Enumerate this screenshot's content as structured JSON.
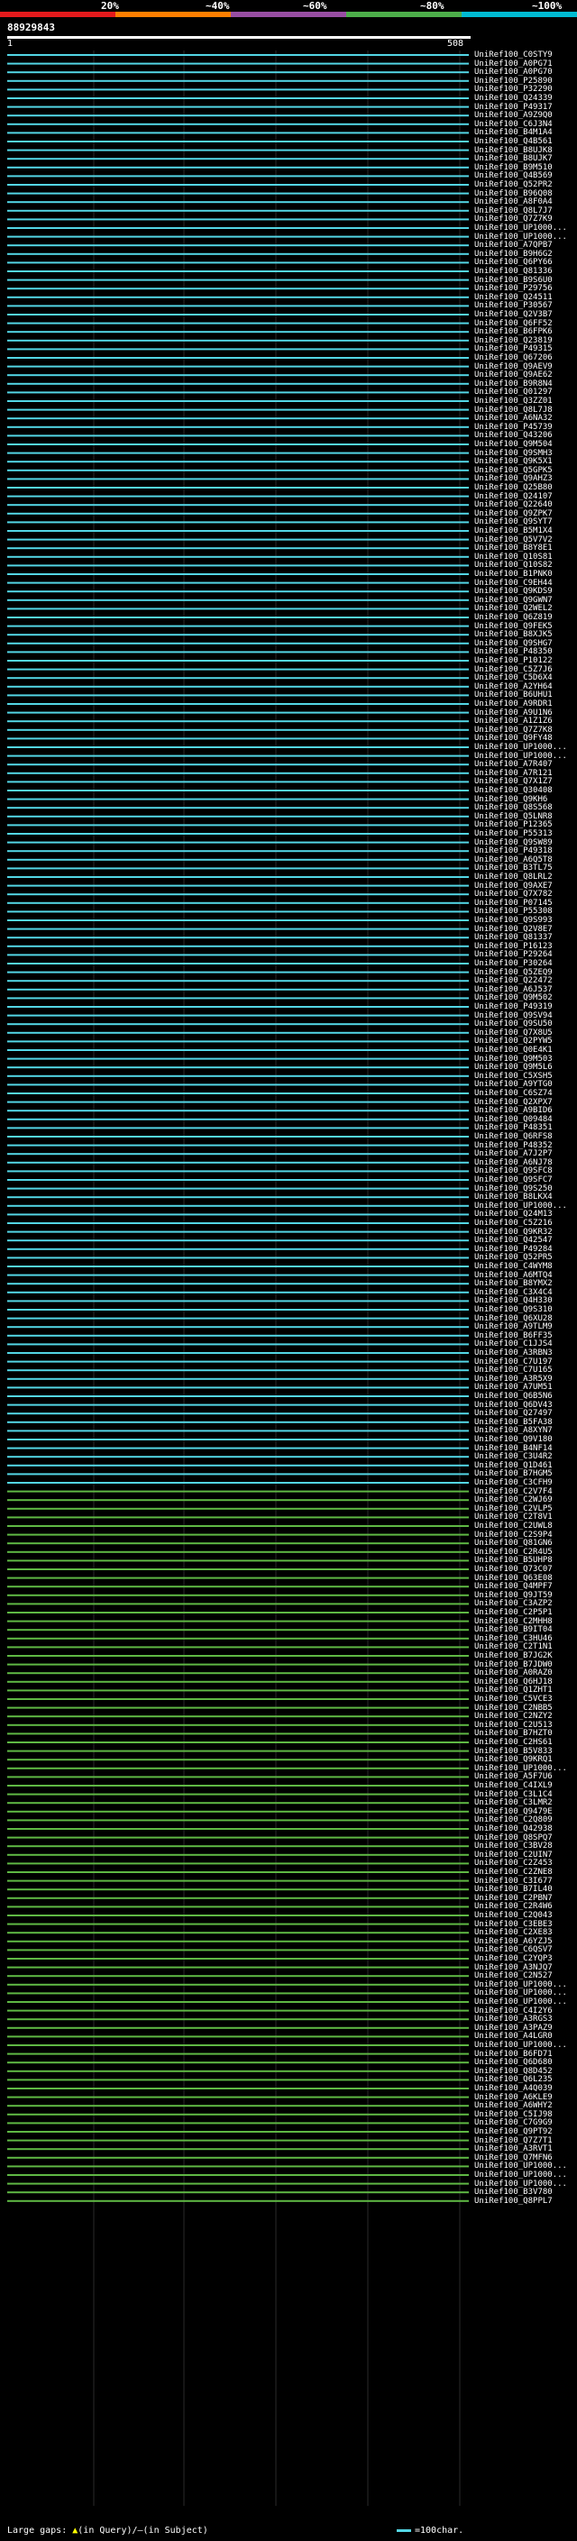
{
  "legend": {
    "ticks": [
      "20%",
      "~40%",
      "~60%",
      "~80%",
      "~100%"
    ],
    "colors": [
      "#e41a1c",
      "#ff7f00",
      "#984ea3",
      "#4daf4a",
      "#00bcd4"
    ]
  },
  "query": {
    "id": "88929843",
    "start": "1",
    "end": "508"
  },
  "hit_colors": {
    "cyan": "#53d6e5",
    "green": "#5fb844"
  },
  "hits": [
    "UniRef100_C0STY9",
    "UniRef100_A0PG71",
    "UniRef100_A0PG70",
    "UniRef100_P25890",
    "UniRef100_P32290",
    "UniRef100_Q24339",
    "UniRef100_P49317",
    "UniRef100_A9Z9Q0",
    "UniRef100_C6J3N4",
    "UniRef100_B4M1A4",
    "UniRef100_Q4B561",
    "UniRef100_B8UJK8",
    "UniRef100_B8UJK7",
    "UniRef100_B9M510",
    "UniRef100_Q4B569",
    "UniRef100_Q52PR2",
    "UniRef100_B96Q08",
    "UniRef100_A8F0A4",
    "UniRef100_Q8L7J7",
    "UniRef100_Q7Z7K9",
    "UniRef100_UP1000...",
    "UniRef100_UP1000...",
    "UniRef100_A7QPB7",
    "UniRef100_B9H6G2",
    "UniRef100_Q6PY66",
    "UniRef100_Q81336",
    "UniRef100_B9S6U0",
    "UniRef100_P29756",
    "UniRef100_Q24511",
    "UniRef100_P30567",
    "UniRef100_Q2V3B7",
    "UniRef100_Q6FF52",
    "UniRef100_B6FPK6",
    "UniRef100_Q23819",
    "UniRef100_P49315",
    "UniRef100_Q67206",
    "UniRef100_Q9AEV9",
    "UniRef100_Q9AE62",
    "UniRef100_B9R8N4",
    "UniRef100_Q01297",
    "UniRef100_Q3ZZ01",
    "UniRef100_Q8L7J8",
    "UniRef100_A6NA32",
    "UniRef100_P45739",
    "UniRef100_Q43206",
    "UniRef100_Q9M504",
    "UniRef100_Q9SMH3",
    "UniRef100_Q9K5X1",
    "UniRef100_Q5GPK5",
    "UniRef100_Q9AHZ3",
    "UniRef100_Q25B80",
    "UniRef100_Q24107",
    "UniRef100_Q22640",
    "UniRef100_Q9ZPK7",
    "UniRef100_Q9SYT7",
    "UniRef100_B5M1X4",
    "UniRef100_Q5V7V2",
    "UniRef100_B8Y8E1",
    "UniRef100_Q10S81",
    "UniRef100_Q10S82",
    "UniRef100_B1PNK0",
    "UniRef100_C9EH44",
    "UniRef100_Q9KDS9",
    "UniRef100_Q9GWN7",
    "UniRef100_Q2WEL2",
    "UniRef100_Q6Z819",
    "UniRef100_Q9FEK5",
    "UniRef100_B8XJK5",
    "UniRef100_Q9SHG7",
    "UniRef100_P48350",
    "UniRef100_P10122",
    "UniRef100_C5Z7J6",
    "UniRef100_C5D6X4",
    "UniRef100_A2YH64",
    "UniRef100_B6UHU1",
    "UniRef100_A9RDR1",
    "UniRef100_A9U1N6",
    "UniRef100_A1Z1Z6",
    "UniRef100_Q7Z7K8",
    "UniRef100_Q9FY48",
    "UniRef100_UP1000...",
    "UniRef100_UP1000...",
    "UniRef100_A7R407",
    "UniRef100_A7R121",
    "UniRef100_Q7X1Z7",
    "UniRef100_Q30408",
    "UniRef100_Q9KH6",
    "UniRef100_Q8S568",
    "UniRef100_Q5LNR8",
    "UniRef100_P12365",
    "UniRef100_P55313",
    "UniRef100_Q9SW89",
    "UniRef100_P49318",
    "UniRef100_A6Q5T8",
    "UniRef100_B3TL75",
    "UniRef100_Q8LRL2",
    "UniRef100_Q9AXE7",
    "UniRef100_Q7X782",
    "UniRef100_P07145",
    "UniRef100_P55308",
    "UniRef100_Q9S993",
    "UniRef100_Q2V8E7",
    "UniRef100_Q81337",
    "UniRef100_P16123",
    "UniRef100_P29264",
    "UniRef100_P30264",
    "UniRef100_Q5ZEQ9",
    "UniRef100_Q22472",
    "UniRef100_A6J537",
    "UniRef100_Q9M502",
    "UniRef100_P49319",
    "UniRef100_Q9SV94",
    "UniRef100_Q9SU50",
    "UniRef100_Q7X8U5",
    "UniRef100_Q2PYW5",
    "UniRef100_Q0E4K1",
    "UniRef100_Q9M503",
    "UniRef100_Q9M5L6",
    "UniRef100_C5XSH5",
    "UniRef100_A9YTG0",
    "UniRef100_C6SZ74",
    "UniRef100_Q2XPX7",
    "UniRef100_A9BID6",
    "UniRef100_Q09484",
    "UniRef100_P48351",
    "UniRef100_Q6RFS8",
    "UniRef100_P48352",
    "UniRef100_A7J2P7",
    "UniRef100_A6NJ78",
    "UniRef100_Q9SFC8",
    "UniRef100_Q9SFC7",
    "UniRef100_Q9S250",
    "UniRef100_B8LKX4",
    "UniRef100_UP1000...",
    "UniRef100_Q24M13",
    "UniRef100_C5Z216",
    "UniRef100_Q9KR32",
    "UniRef100_Q42547",
    "UniRef100_P49284",
    "UniRef100_Q52PR5",
    "UniRef100_C4WYM8",
    "UniRef100_A6MTQ4",
    "UniRef100_B8YMX2",
    "UniRef100_C3X4C4",
    "UniRef100_Q4H330",
    "UniRef100_Q9S310",
    "UniRef100_Q6XU28",
    "UniRef100_A9TLM9",
    "UniRef100_B6FF35",
    "UniRef100_C1JJS4",
    "UniRef100_A3RBN3",
    "UniRef100_C7U197",
    "UniRef100_C7U165",
    "UniRef100_A3R5X9",
    "UniRef100_A7UM51",
    "UniRef100_Q6B5N6",
    "UniRef100_Q6DV43",
    "UniRef100_Q27497",
    "UniRef100_B5FA38",
    "UniRef100_A8XYN7",
    "UniRef100_Q9V180",
    "UniRef100_B4NF14",
    "UniRef100_C3U4R2",
    "UniRef100_Q1D461",
    "UniRef100_B7HGM5",
    "UniRef100_C3CFH9",
    "UniRef100_C2V7F4",
    "UniRef100_C2WJ69",
    "UniRef100_C2VLP5",
    "UniRef100_C2T8V1",
    "UniRef100_C2UWL8",
    "UniRef100_C2S9P4",
    "UniRef100_Q81GN6",
    "UniRef100_C2R4U5",
    "UniRef100_B5UHP8",
    "UniRef100_Q73C07",
    "UniRef100_Q63E08",
    "UniRef100_Q4MPF7",
    "UniRef100_Q9JT59",
    "UniRef100_C3AZP2",
    "UniRef100_C2P5P1",
    "UniRef100_C2MHH8",
    "UniRef100_B9IT04",
    "UniRef100_C3HU46",
    "UniRef100_C2T1N1",
    "UniRef100_B7JG2K",
    "UniRef100_B7JDW0",
    "UniRef100_A0RAZ0",
    "UniRef100_Q6HJ18",
    "UniRef100_Q1ZHT1",
    "UniRef100_C5VCE3",
    "UniRef100_C2NBB5",
    "UniRef100_C2NZY2",
    "UniRef100_C2U513",
    "UniRef100_B7HZT0",
    "UniRef100_C2HS61",
    "UniRef100_B5V833",
    "UniRef100_Q9KRQ1",
    "UniRef100_UP1000...",
    "UniRef100_A5F7U6",
    "UniRef100_C4IXL9",
    "UniRef100_C3L1C4",
    "UniRef100_C3LMR2",
    "UniRef100_Q9479E",
    "UniRef100_C2Q809",
    "UniRef100_Q42938",
    "UniRef100_Q8SPQ7",
    "UniRef100_C3BV28",
    "UniRef100_C2UIN7",
    "UniRef100_C2Z453",
    "UniRef100_C2ZNE8",
    "UniRef100_C3I677",
    "UniRef100_B7IL40",
    "UniRef100_C2PBN7",
    "UniRef100_C2R4W6",
    "UniRef100_C2Q043",
    "UniRef100_C3EBE3",
    "UniRef100_C2XE83",
    "UniRef100_A6YZJ5",
    "UniRef100_C6QSV7",
    "UniRef100_C2YQP3",
    "UniRef100_A3NJQ7",
    "UniRef100_C2N527",
    "UniRef100_UP1000...",
    "UniRef100_UP1000...",
    "UniRef100_UP1000...",
    "UniRef100_C4I2Y6",
    "UniRef100_A3RGS3",
    "UniRef100_A3PAZ9",
    "UniRef100_A4LGR0",
    "UniRef100_UP1000...",
    "UniRef100_B6FD71",
    "UniRef100_Q6D680",
    "UniRef100_Q8D452",
    "UniRef100_Q6L235",
    "UniRef100_A4Q039",
    "UniRef100_A6KLE9",
    "UniRef100_A6WHY2",
    "UniRef100_C5IJ98",
    "UniRef100_C7G9G9",
    "UniRef100_Q9PT92",
    "UniRef100_Q7Z7T1",
    "UniRef100_A3RVT1",
    "UniRef100_Q7MFN6",
    "UniRef100_UP1000...",
    "UniRef100_UP1000...",
    "UniRef100_UP1000...",
    "UniRef100_B3V780",
    "UniRef100_Q8PPL7"
  ]
}
